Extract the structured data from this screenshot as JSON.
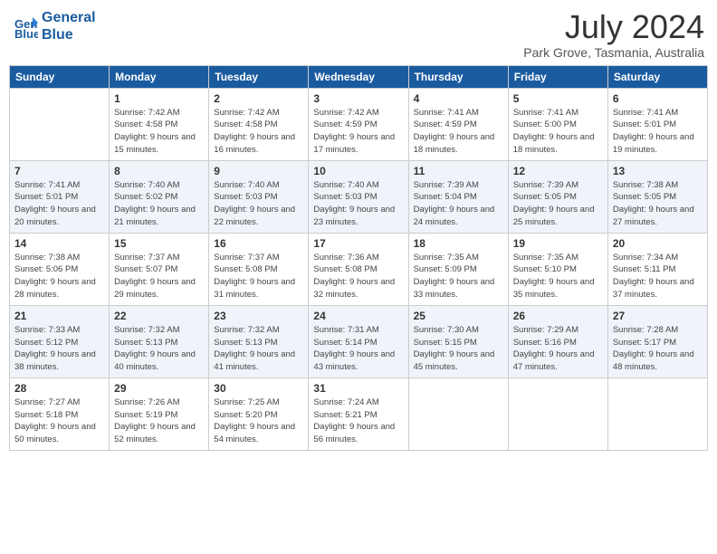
{
  "header": {
    "logo_line1": "General",
    "logo_line2": "Blue",
    "month_year": "July 2024",
    "location": "Park Grove, Tasmania, Australia"
  },
  "days_of_week": [
    "Sunday",
    "Monday",
    "Tuesday",
    "Wednesday",
    "Thursday",
    "Friday",
    "Saturday"
  ],
  "weeks": [
    [
      {
        "day": "",
        "info": ""
      },
      {
        "day": "1",
        "info": "Sunrise: 7:42 AM\nSunset: 4:58 PM\nDaylight: 9 hours\nand 15 minutes."
      },
      {
        "day": "2",
        "info": "Sunrise: 7:42 AM\nSunset: 4:58 PM\nDaylight: 9 hours\nand 16 minutes."
      },
      {
        "day": "3",
        "info": "Sunrise: 7:42 AM\nSunset: 4:59 PM\nDaylight: 9 hours\nand 17 minutes."
      },
      {
        "day": "4",
        "info": "Sunrise: 7:41 AM\nSunset: 4:59 PM\nDaylight: 9 hours\nand 18 minutes."
      },
      {
        "day": "5",
        "info": "Sunrise: 7:41 AM\nSunset: 5:00 PM\nDaylight: 9 hours\nand 18 minutes."
      },
      {
        "day": "6",
        "info": "Sunrise: 7:41 AM\nSunset: 5:01 PM\nDaylight: 9 hours\nand 19 minutes."
      }
    ],
    [
      {
        "day": "7",
        "info": "Sunrise: 7:41 AM\nSunset: 5:01 PM\nDaylight: 9 hours\nand 20 minutes."
      },
      {
        "day": "8",
        "info": "Sunrise: 7:40 AM\nSunset: 5:02 PM\nDaylight: 9 hours\nand 21 minutes."
      },
      {
        "day": "9",
        "info": "Sunrise: 7:40 AM\nSunset: 5:03 PM\nDaylight: 9 hours\nand 22 minutes."
      },
      {
        "day": "10",
        "info": "Sunrise: 7:40 AM\nSunset: 5:03 PM\nDaylight: 9 hours\nand 23 minutes."
      },
      {
        "day": "11",
        "info": "Sunrise: 7:39 AM\nSunset: 5:04 PM\nDaylight: 9 hours\nand 24 minutes."
      },
      {
        "day": "12",
        "info": "Sunrise: 7:39 AM\nSunset: 5:05 PM\nDaylight: 9 hours\nand 25 minutes."
      },
      {
        "day": "13",
        "info": "Sunrise: 7:38 AM\nSunset: 5:05 PM\nDaylight: 9 hours\nand 27 minutes."
      }
    ],
    [
      {
        "day": "14",
        "info": "Sunrise: 7:38 AM\nSunset: 5:06 PM\nDaylight: 9 hours\nand 28 minutes."
      },
      {
        "day": "15",
        "info": "Sunrise: 7:37 AM\nSunset: 5:07 PM\nDaylight: 9 hours\nand 29 minutes."
      },
      {
        "day": "16",
        "info": "Sunrise: 7:37 AM\nSunset: 5:08 PM\nDaylight: 9 hours\nand 31 minutes."
      },
      {
        "day": "17",
        "info": "Sunrise: 7:36 AM\nSunset: 5:08 PM\nDaylight: 9 hours\nand 32 minutes."
      },
      {
        "day": "18",
        "info": "Sunrise: 7:35 AM\nSunset: 5:09 PM\nDaylight: 9 hours\nand 33 minutes."
      },
      {
        "day": "19",
        "info": "Sunrise: 7:35 AM\nSunset: 5:10 PM\nDaylight: 9 hours\nand 35 minutes."
      },
      {
        "day": "20",
        "info": "Sunrise: 7:34 AM\nSunset: 5:11 PM\nDaylight: 9 hours\nand 37 minutes."
      }
    ],
    [
      {
        "day": "21",
        "info": "Sunrise: 7:33 AM\nSunset: 5:12 PM\nDaylight: 9 hours\nand 38 minutes."
      },
      {
        "day": "22",
        "info": "Sunrise: 7:32 AM\nSunset: 5:13 PM\nDaylight: 9 hours\nand 40 minutes."
      },
      {
        "day": "23",
        "info": "Sunrise: 7:32 AM\nSunset: 5:13 PM\nDaylight: 9 hours\nand 41 minutes."
      },
      {
        "day": "24",
        "info": "Sunrise: 7:31 AM\nSunset: 5:14 PM\nDaylight: 9 hours\nand 43 minutes."
      },
      {
        "day": "25",
        "info": "Sunrise: 7:30 AM\nSunset: 5:15 PM\nDaylight: 9 hours\nand 45 minutes."
      },
      {
        "day": "26",
        "info": "Sunrise: 7:29 AM\nSunset: 5:16 PM\nDaylight: 9 hours\nand 47 minutes."
      },
      {
        "day": "27",
        "info": "Sunrise: 7:28 AM\nSunset: 5:17 PM\nDaylight: 9 hours\nand 48 minutes."
      }
    ],
    [
      {
        "day": "28",
        "info": "Sunrise: 7:27 AM\nSunset: 5:18 PM\nDaylight: 9 hours\nand 50 minutes."
      },
      {
        "day": "29",
        "info": "Sunrise: 7:26 AM\nSunset: 5:19 PM\nDaylight: 9 hours\nand 52 minutes."
      },
      {
        "day": "30",
        "info": "Sunrise: 7:25 AM\nSunset: 5:20 PM\nDaylight: 9 hours\nand 54 minutes."
      },
      {
        "day": "31",
        "info": "Sunrise: 7:24 AM\nSunset: 5:21 PM\nDaylight: 9 hours\nand 56 minutes."
      },
      {
        "day": "",
        "info": ""
      },
      {
        "day": "",
        "info": ""
      },
      {
        "day": "",
        "info": ""
      }
    ]
  ]
}
